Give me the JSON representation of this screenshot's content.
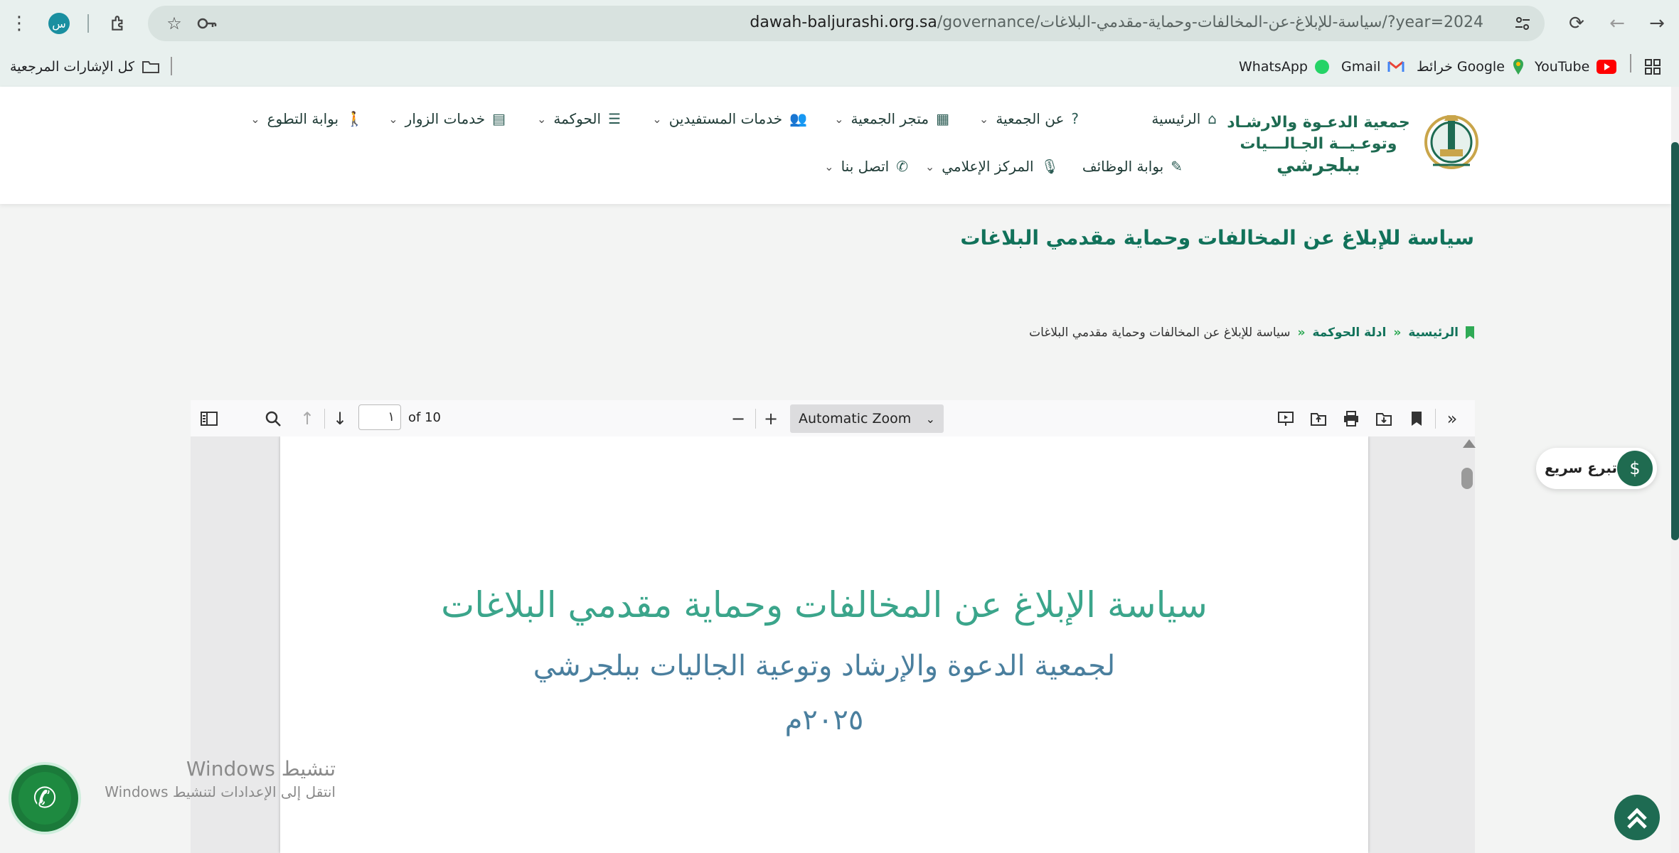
{
  "browser": {
    "profile_initial": "س",
    "url_host": "dawah-baljurashi.org.sa",
    "url_path": "/governance/سياسة-للإبلاغ-عن-المخالفات-وحماية-مقدمي-البلاغات/?year=2024",
    "bookmarks": [
      {
        "label": "YouTube",
        "icon": "youtube-icon"
      },
      {
        "label": "خرائط Google",
        "icon": "maps-icon"
      },
      {
        "label": "Gmail",
        "icon": "gmail-icon"
      },
      {
        "label": "WhatsApp",
        "icon": "whatsapp-icon"
      }
    ],
    "all_bookmarks_label": "كل الإشارات المرجعية"
  },
  "site": {
    "logo_text": {
      "line1": "جمعية الدعـوة والارشـاد",
      "line2": "وتوعـيــة الجـالـــيات",
      "line3": "ببلجرشي"
    },
    "nav_row1": [
      {
        "label": "الرئيسية",
        "icon": "home-icon",
        "has_dropdown": false
      },
      {
        "label": "عن الجمعية",
        "icon": "question-icon",
        "has_dropdown": true
      },
      {
        "label": "متجر الجمعية",
        "icon": "calendar-icon",
        "has_dropdown": true
      },
      {
        "label": "خدمات المستفيدين",
        "icon": "users-icon",
        "has_dropdown": true
      },
      {
        "label": "الحوكمة",
        "icon": "list-icon",
        "has_dropdown": true
      },
      {
        "label": "خدمات الزوار",
        "icon": "server-icon",
        "has_dropdown": true
      },
      {
        "label": "بوابة التطوع",
        "icon": "walking-icon",
        "has_dropdown": true
      }
    ],
    "nav_row2": [
      {
        "label": "بوابة الوظائف",
        "icon": "edit-icon",
        "has_dropdown": false
      },
      {
        "label": "المركز الإعلامي",
        "icon": "microphone-icon",
        "has_dropdown": true
      },
      {
        "label": "اتصل بنا",
        "icon": "phone-icon",
        "has_dropdown": true
      }
    ]
  },
  "page": {
    "title": "سياسة للإبلاغ عن المخالفات وحماية مقدمي البلاغات",
    "breadcrumb": {
      "home": "الرئيسية",
      "section": "ادلة الحوكمة",
      "current": "سياسة للإبلاغ عن المخالفات وحماية مقدمي البلاغات"
    }
  },
  "pdf_viewer": {
    "page_number": "١",
    "page_total": "of 10",
    "zoom": "Automatic Zoom",
    "document": {
      "title": "سياسة الإبلاغ عن المخالفات وحماية مقدمي البلاغات",
      "subtitle": "لجمعية الدعوة والإرشاد وتوعية الجاليات ببلجرشي",
      "year": "٢٠٢٥م"
    }
  },
  "widgets": {
    "donate_label": "تبرع سريع",
    "activation_title": "تنشيط Windows",
    "activation_hint": "انتقل إلى الإعدادات لتنشيط Windows"
  },
  "colors": {
    "brand_green": "#11725a",
    "breadcrumb_separator": "#2faa55",
    "doc_title": "#3ba58b",
    "doc_sub": "#4a7f9e"
  }
}
